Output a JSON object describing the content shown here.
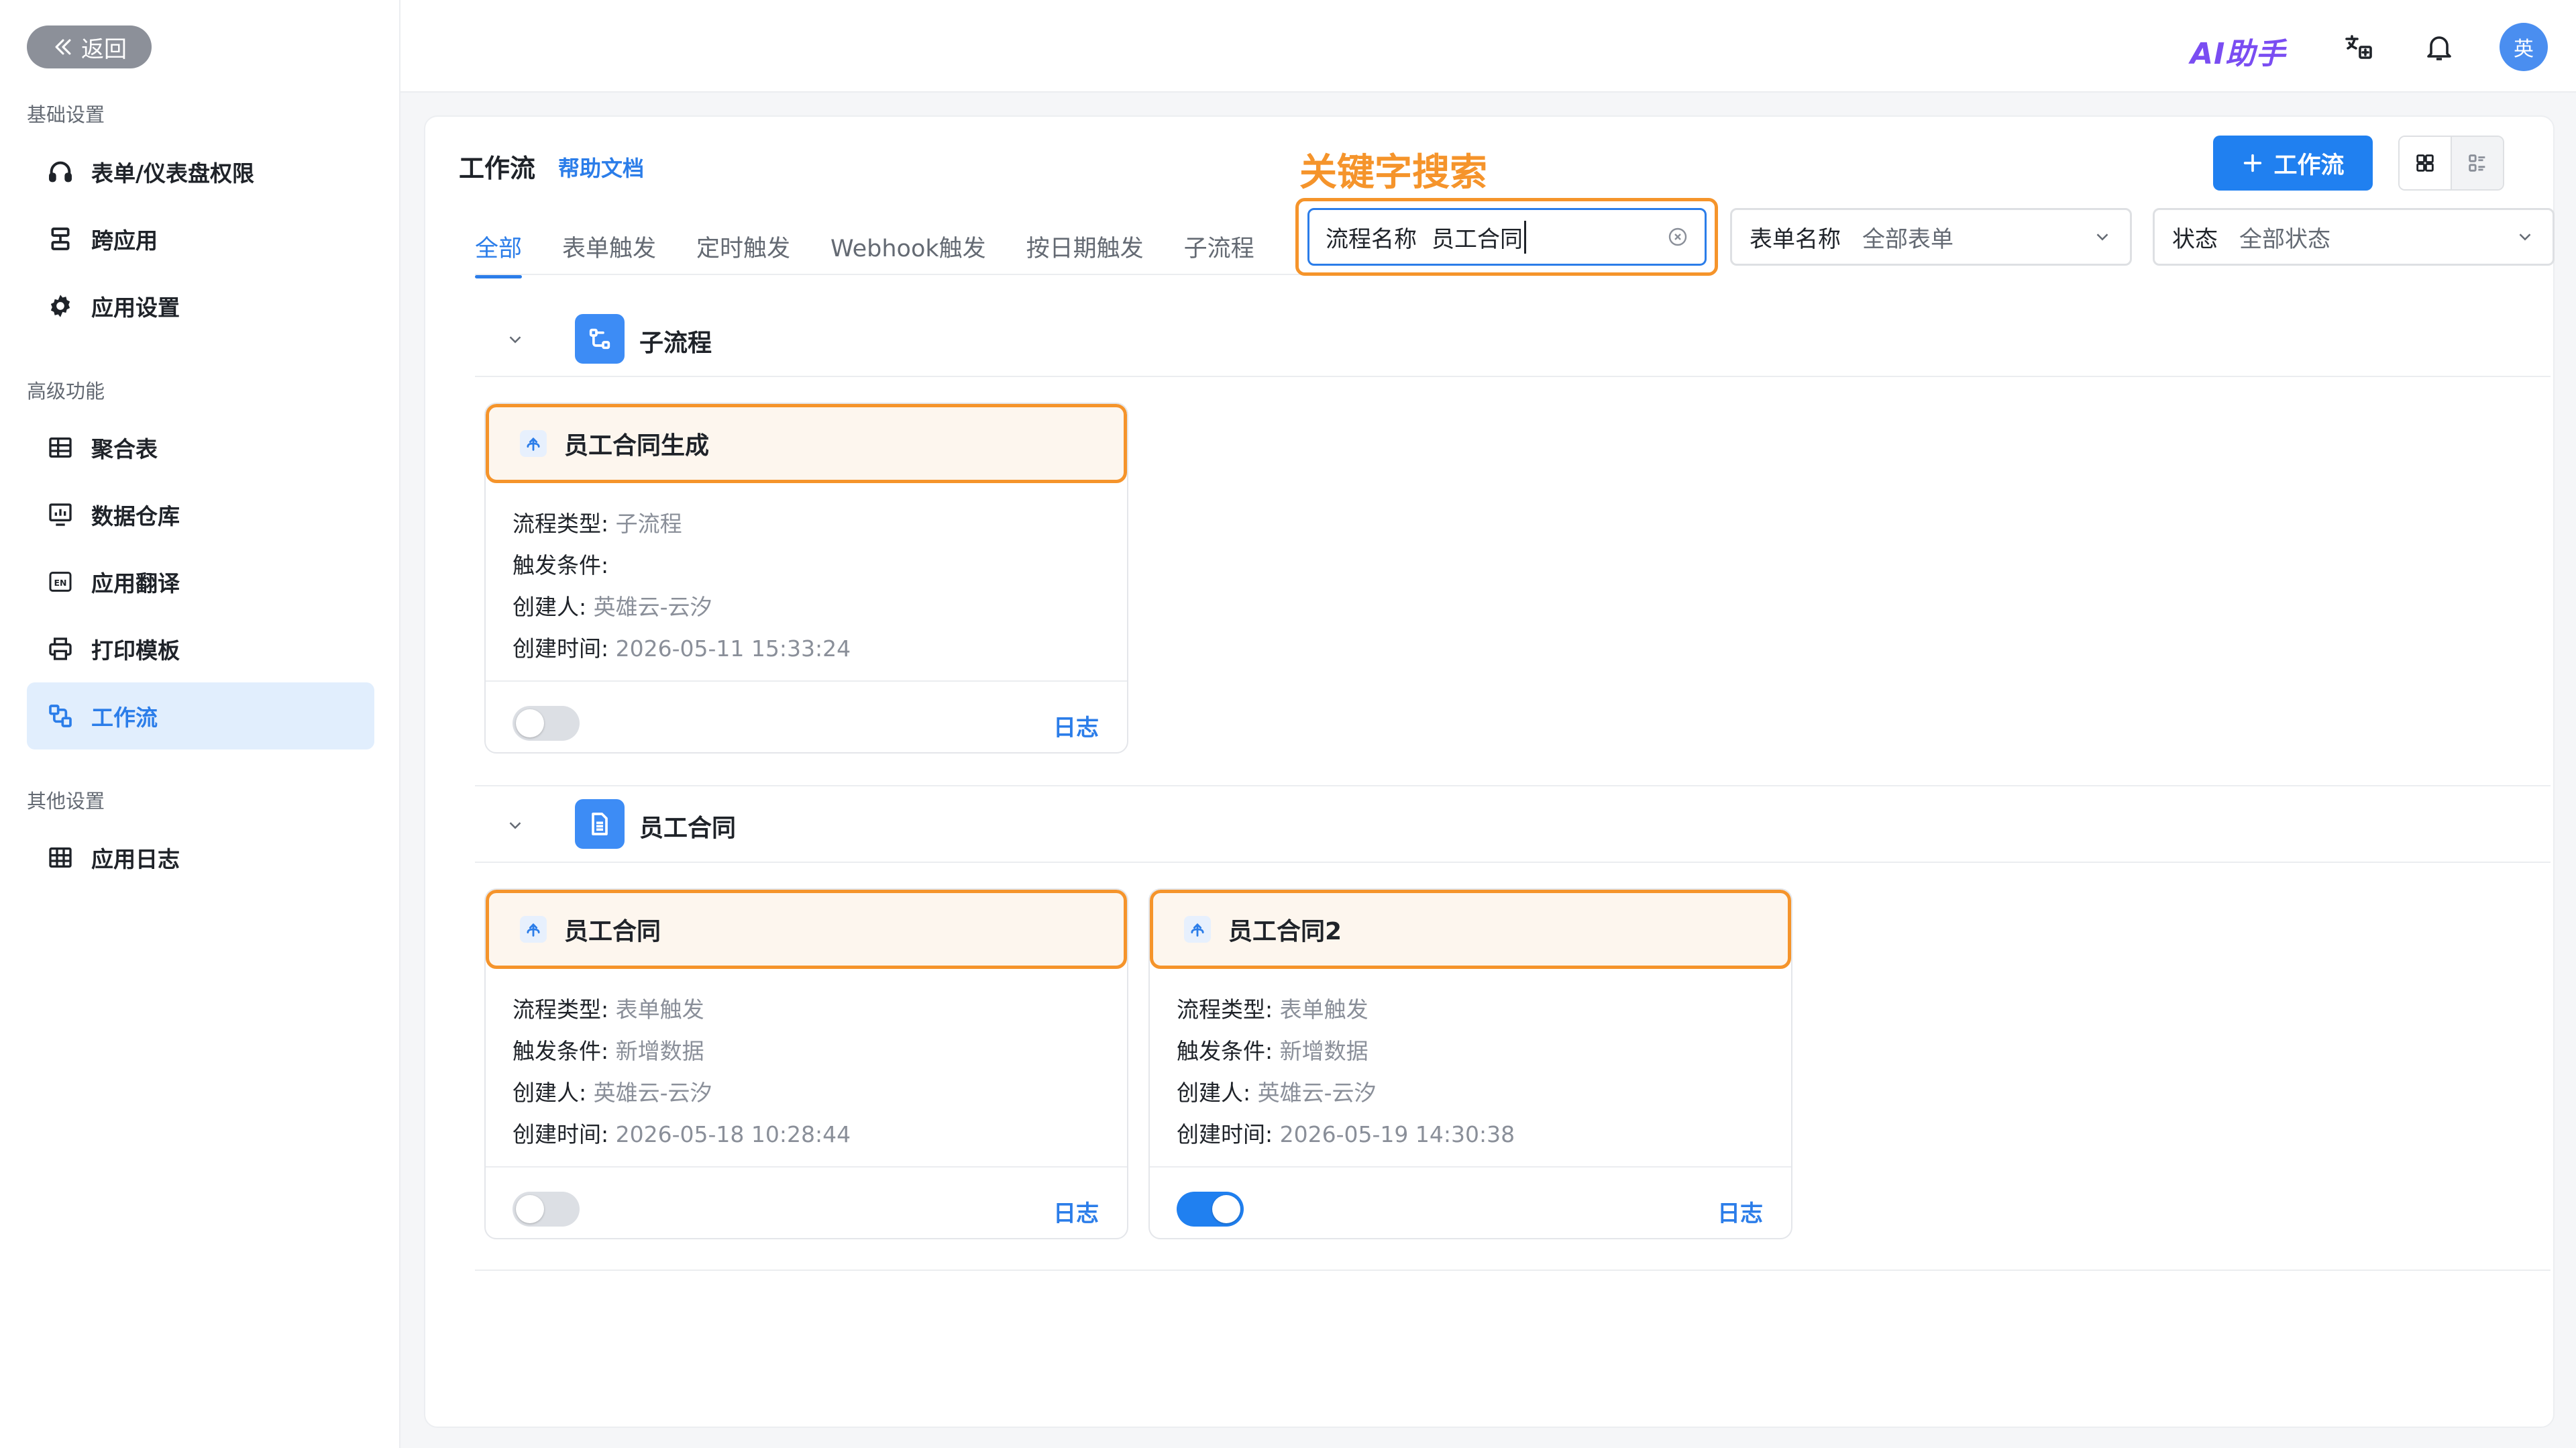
{
  "sidebar": {
    "back_label": "返回",
    "sections": [
      {
        "title": "基础设置",
        "items": [
          {
            "label": "表单/仪表盘权限",
            "icon": "headset-icon"
          },
          {
            "label": "跨应用",
            "icon": "server-icon"
          },
          {
            "label": "应用设置",
            "icon": "gear-icon"
          }
        ]
      },
      {
        "title": "高级功能",
        "items": [
          {
            "label": "聚合表",
            "icon": "table-icon"
          },
          {
            "label": "数据仓库",
            "icon": "chart-monitor-icon"
          },
          {
            "label": "应用翻译",
            "icon": "translate-en-icon"
          },
          {
            "label": "打印模板",
            "icon": "printer-icon"
          },
          {
            "label": "工作流",
            "icon": "workflow-icon",
            "active": true
          }
        ]
      },
      {
        "title": "其他设置",
        "items": [
          {
            "label": "应用日志",
            "icon": "grid-icon"
          }
        ]
      }
    ]
  },
  "topbar": {
    "ai_label": "AI助手",
    "avatar_text": "英",
    "icons": [
      "translate-icon",
      "bell-icon"
    ]
  },
  "header": {
    "title": "工作流",
    "help_link": "帮助文档",
    "add_button": "工作流",
    "annotation": "关键字搜索"
  },
  "tabs": [
    "全部",
    "表单触发",
    "定时触发",
    "Webhook触发",
    "按日期触发",
    "子流程"
  ],
  "filters": {
    "search": {
      "label": "流程名称",
      "value": "员工合同"
    },
    "form": {
      "label": "表单名称",
      "value": "全部表单"
    },
    "status": {
      "label": "状态",
      "value": "全部状态"
    }
  },
  "field_labels": {
    "type": "流程类型:",
    "trigger": "触发条件:",
    "creator": "创建人:",
    "created": "创建时间:",
    "log": "日志"
  },
  "groups": [
    {
      "name": "子流程",
      "icon": "subflow-icon",
      "cards": [
        {
          "title": "员工合同生成",
          "type": "子流程",
          "trigger": "",
          "creator": "英雄云-云汐",
          "created": "2026-05-11 15:33:24",
          "enabled": false
        }
      ]
    },
    {
      "name": "员工合同",
      "icon": "document-icon",
      "cards": [
        {
          "title": "员工合同",
          "type": "表单触发",
          "trigger": "新增数据",
          "creator": "英雄云-云汐",
          "created": "2026-05-18 10:28:44",
          "enabled": false
        },
        {
          "title": "员工合同2",
          "type": "表单触发",
          "trigger": "新增数据",
          "creator": "英雄云-云汐",
          "created": "2026-05-19 14:30:38",
          "enabled": true
        }
      ]
    }
  ]
}
